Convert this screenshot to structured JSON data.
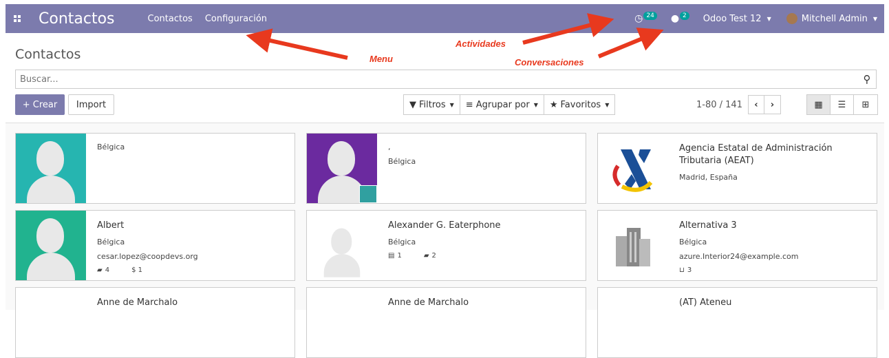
{
  "navbar": {
    "brand": "Contactos",
    "menu": [
      "Contactos",
      "Configuración"
    ],
    "activities_count": "24",
    "messages_count": "2",
    "company": "Odoo Test 12",
    "user": "Mitchell Admin",
    "color": "#7c7bad"
  },
  "control": {
    "title": "Contactos",
    "search_placeholder": "Buscar...",
    "create_label": "+ Crear",
    "import_label": "Import",
    "filters_label": "Filtros",
    "groupby_label": "Agrupar por",
    "favorites_label": "Favoritos",
    "pager_text": "1-80 / 141"
  },
  "annotations": {
    "menu": "Menu",
    "activities": "Actividades",
    "conversations": "Conversaciones"
  },
  "cards": [
    {
      "name": "",
      "line1": "Bélgica",
      "line2": "",
      "avatar": "teal"
    },
    {
      "name": ",",
      "line1": "Bélgica",
      "line2": "",
      "avatar": "purple"
    },
    {
      "name": "Agencia Estatal de Administración Tributaria (AEAT)",
      "line1": "Madrid, España",
      "line2": "",
      "avatar": "aeat-logo"
    },
    {
      "name": "Albert",
      "line1": "Bélgica",
      "line2": "cesar.lopez@coopdevs.org",
      "stat1": "4",
      "stat2": "$ 1",
      "avatar": "teal"
    },
    {
      "name": "Alexander G. Eaterphone",
      "line1": "Bélgica",
      "line2": "",
      "stat1": "1",
      "stat2": "2",
      "avatar": "white"
    },
    {
      "name": "Alternativa 3",
      "line1": "Bélgica",
      "line2": "azure.Interior24@example.com",
      "stat1": "3",
      "avatar": "building"
    },
    {
      "name": "Anne de Marchalo",
      "avatar": "white"
    },
    {
      "name": "Anne de Marchalo",
      "avatar": "white"
    },
    {
      "name": "(AT) Ateneu",
      "avatar": "white"
    }
  ]
}
